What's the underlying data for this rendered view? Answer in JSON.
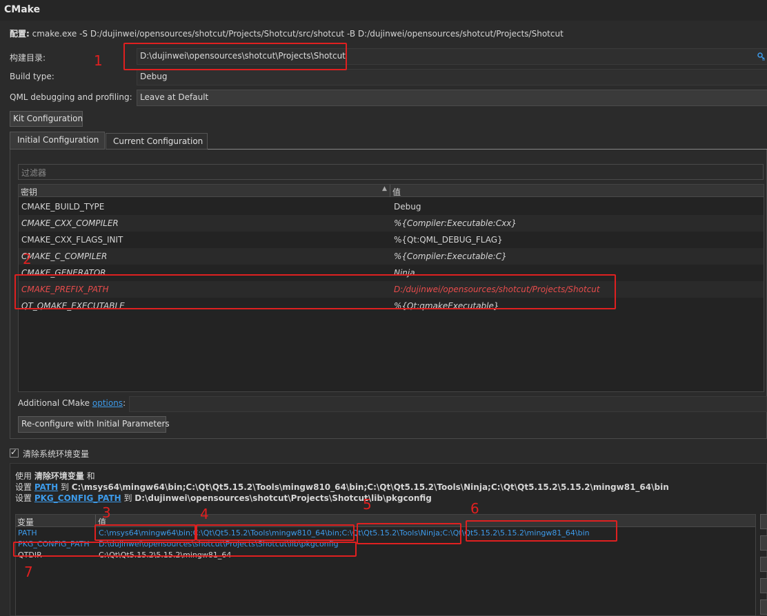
{
  "window": {
    "title": "CMake"
  },
  "config_line": {
    "label": "配置:",
    "command": " cmake.exe -S D:/dujinwei/opensources/shotcut/Projects/Shotcut/src/shotcut -B D:/dujinwei/opensources/shotcut/Projects/Shotcut"
  },
  "build_dir": {
    "label": "构建目录:",
    "value": "D:\\dujinwei\\opensources\\shotcut\\Projects\\Shotcut",
    "browse_icon": "browse-icon"
  },
  "build_type": {
    "label": "Build type:",
    "value": "Debug"
  },
  "qml_debugging": {
    "label": "QML debugging and profiling:",
    "value": "Leave at Default"
  },
  "kit_button": "Kit Configuration",
  "tabs": [
    {
      "label": "Initial Configuration",
      "active": true
    },
    {
      "label": "Current Configuration",
      "active": false
    }
  ],
  "filter": {
    "placeholder": "过滤器"
  },
  "table": {
    "col_key": "密钥",
    "col_value": "值",
    "sort_icon": "sort-up-icon",
    "rows": [
      {
        "key": "CMAKE_BUILD_TYPE",
        "value": "Debug",
        "italic": false,
        "highlight": false
      },
      {
        "key": "CMAKE_CXX_COMPILER",
        "value": "%{Compiler:Executable:Cxx}",
        "italic": true,
        "highlight": false
      },
      {
        "key": "CMAKE_CXX_FLAGS_INIT",
        "value": "%{Qt:QML_DEBUG_FLAG}",
        "italic": false,
        "highlight": false
      },
      {
        "key": "CMAKE_C_COMPILER",
        "value": "%{Compiler:Executable:C}",
        "italic": true,
        "highlight": false
      },
      {
        "key": "CMAKE_GENERATOR",
        "value": "Ninja",
        "italic": true,
        "highlight": false
      },
      {
        "key": "CMAKE_PREFIX_PATH",
        "value": "D:/dujinwei/opensources/shotcut/Projects/Shotcut",
        "italic": true,
        "highlight": true
      },
      {
        "key": "QT_QMAKE_EXECUTABLE",
        "value": "%{Qt:qmakeExecutable}",
        "italic": true,
        "highlight": false
      }
    ]
  },
  "additional": {
    "label": "Additional CMake ",
    "link": "options",
    "colon": ":"
  },
  "reconfigure_button": "Re-configure with Initial Parameters",
  "clear_env": {
    "label": "清除系统环境变量",
    "checked": true,
    "check_icon": "checkmark-icon"
  },
  "env_summary": {
    "line1_prefix": "使用 ",
    "line1_bold": "清除环境变量",
    "line1_suffix": " 和",
    "line2_prefix": "设置 ",
    "line2_var": "PATH",
    "line2_to": " 到 ",
    "line2_value": "C:\\msys64\\mingw64\\bin;C:\\Qt\\Qt5.15.2\\Tools\\mingw810_64\\bin;C:\\Qt\\Qt5.15.2\\Tools\\Ninja;C:\\Qt\\Qt5.15.2\\5.15.2\\mingw81_64\\bin",
    "line3_prefix": "设置 ",
    "line3_var": "PKG_CONFIG_PATH",
    "line3_to": " 到 ",
    "line3_value": "D:\\dujinwei\\opensources\\shotcut\\Projects\\Shotcut\\lib\\pkgconfig"
  },
  "env_table": {
    "col_var": "变量",
    "col_value": "值",
    "path": {
      "name": "PATH",
      "seg1": "C:\\msys64\\mingw64\\bin",
      "sep1": ";",
      "seg2": "C:\\Qt\\Qt5.15.2\\Tools\\mingw810_64\\bin",
      "sep2": ";",
      "seg3": "C:\\Qt\\Qt5.15.2\\Tools\\Ninja",
      "sep3": ";",
      "seg4": "C:\\Qt\\Qt5.15.2\\5.15.2\\mingw81_64\\bin"
    },
    "pkg": {
      "name": "PKG_CONFIG_PATH",
      "value": "D:\\dujinwei\\opensources\\shotcut\\Projects\\Shotcut\\lib\\pkgconfig"
    },
    "qtdir": {
      "name": "QTDIR",
      "value": "C:\\Qt\\Qt5.15.2\\5.15.2\\mingw81_64"
    }
  },
  "annotations": [
    "1",
    "2",
    "3",
    "4",
    "5",
    "6",
    "7"
  ],
  "colors": {
    "background": "#2b2b2b",
    "annotation": "#e02020",
    "link": "#3d9bea",
    "highlight_text": "#e84c4c"
  }
}
